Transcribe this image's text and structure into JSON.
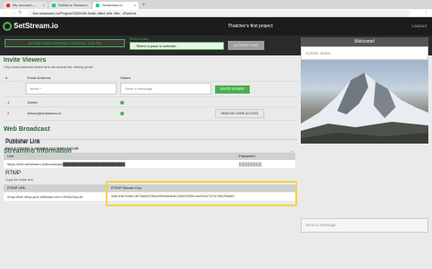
{
  "browser": {
    "tabs": [
      {
        "label": "My account — Setlist.io",
        "close": "×"
      },
      {
        "label": "Setlist.io Session Insi...",
        "close": "×"
      },
      {
        "label": "Setstream.io",
        "close": "×"
      }
    ],
    "new_tab": "+",
    "url": "live.setstream.io/Project/3335939-8c6e-48e4-b9e-39e.../Flashnt",
    "nav": {
      "back": "←",
      "forward": "→",
      "reload": "↻",
      "menu": "⋮"
    }
  },
  "header": {
    "brand": "SetStream.io",
    "project_title": "Thatcher's first project",
    "logout": "LOGOUT"
  },
  "subbar": {
    "active_pass": "ACTIVE PASS EXPIRES 7/13/2021, 5:51 PM",
    "select_label": "Select a pass",
    "select_value": "- Select a pass to activate -",
    "activate_button": "ACTIVATE PASS"
  },
  "sidebar": {
    "welcome": "Welcome!",
    "status_placeholder": "Update status",
    "message_placeholder": "Send a message"
  },
  "invite": {
    "title": "Invite Viewers",
    "subtitle": "Only email addresses listed here can access the viewing portal",
    "columns": [
      "#",
      "Email Address",
      "Status"
    ],
    "new_row": {
      "index": "-",
      "email_placeholder": "email *",
      "message_placeholder": "Send a message",
      "button": "INVITE VIEWER"
    },
    "rows": [
      {
        "index": "1",
        "email": "Admin",
        "status": "on"
      },
      {
        "index": "2",
        "email": "kelsey@setstream.io",
        "status": "on",
        "button": "REMOVE USER ACCESS"
      }
    ]
  },
  "web_broadcast": {
    "title": "Web Broadcast"
  },
  "streaming": {
    "title": "Streaming Information",
    "publisher": {
      "title": "Publisher Link",
      "subtitle": "Send to streamer to managing your stream from set",
      "link_header": "Link",
      "link_value": "https://live.setstream.io/Broadcast/████████████████████████",
      "password_header": "Password",
      "password_value": "████████"
    },
    "rtmp": {
      "title": "RTMP",
      "subtitle": "Copy the entire text",
      "url_header": "RTMP URL",
      "url_value": "rtmp://live-rtmp-pub.millicast.com:1935/v2/pub/",
      "key_header": "RTMP Stream Key",
      "key_value": "dc4h1e6n?token=3b74ae60d75fca4b99dd6da4b1406424529e1add74ed72a7d7e5c298ba54"
    }
  },
  "colors": {
    "accent": "#4caf50",
    "highlight": "#f5d442",
    "header_bg": "#1c1c1c"
  }
}
